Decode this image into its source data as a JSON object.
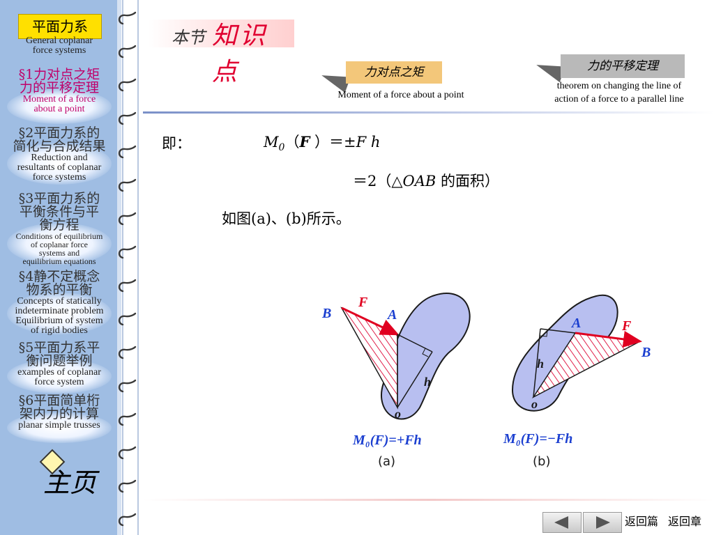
{
  "sidebar": {
    "section_tag": "平面力系",
    "intro_en_1": "General coplanar",
    "intro_en_2": "force systems",
    "items": [
      {
        "zh_1": "§1力对点之矩",
        "zh_2": "力的平移定理",
        "en_1": "Moment of a force",
        "en_2": "about a point",
        "active": true
      },
      {
        "zh_1": "§2平面力系的",
        "zh_2": "简化与合成结果",
        "en_1": "Reduction and",
        "en_2": "resultants of coplanar",
        "en_3": "force systems"
      },
      {
        "zh_1": "§3平面力系的",
        "zh_2": "平衡条件与平",
        "zh_3": "衡方程",
        "en_1": "Conditions of  equilibrium",
        "en_2": "of coplanar force",
        "en_3": "systems and",
        "en_4": "equilibrium equations"
      },
      {
        "zh_1": "§4静不定概念",
        "zh_2": "物系的平衡",
        "en_1": "Concepts of statically",
        "en_2": "indeterminate problem",
        "en_3": "Equilibrium of system",
        "en_4": "of rigid bodies"
      },
      {
        "zh_1": "§5平面力系平",
        "zh_2": "衡问题举例",
        "en_1": "examples of coplanar",
        "en_2": "force system"
      },
      {
        "zh_1": "§6平面简单桁",
        "zh_2": "架内力的计算",
        "en_1": "planar simple trusses"
      }
    ],
    "home_label": "主页"
  },
  "header": {
    "logo_text_1": "本节",
    "logo_text_2": "知识点",
    "tab1": {
      "label": "力对点之矩",
      "en": "Moment of a force about a point"
    },
    "tab2": {
      "label": "力的平移定理",
      "en_1": "theorem on changing the line of",
      "en_2": "action of a force to a parallel line"
    }
  },
  "content": {
    "line1_prefix": "即：",
    "line1_M": "M",
    "line1_sub": "0",
    "line1_open": "（",
    "line1_F": "F",
    "line1_rest": " ）＝±",
    "line1_F2": "F",
    "line1_h": " h",
    "line2_eq": "＝2（",
    "line2_tri": "△OAB",
    "line2_rest": " 的面积）",
    "line3": "如图(a)、(b)所示。"
  },
  "figures": {
    "a": {
      "label_B": "B",
      "label_F": "F",
      "label_A": "A",
      "label_h": "h",
      "label_o": "o",
      "formula": "M₀(F)=+Fh",
      "caption": "(a)"
    },
    "b": {
      "label_A": "A",
      "label_F": "F",
      "label_B": "B",
      "label_h": "h",
      "label_o": "o",
      "formula": "M₀(F)=−Fh",
      "caption": "(b)"
    },
    "colors": {
      "body": "#b8bff0",
      "outline": "#1a1a1a",
      "force": "#e00020",
      "hatch": "#e0204a",
      "formula": "#1b3fd0"
    }
  },
  "footer": {
    "prev_icon": "prev-arrow-icon",
    "next_icon": "next-arrow-icon",
    "back_section": "返回篇",
    "back_chapter": "返回章"
  }
}
